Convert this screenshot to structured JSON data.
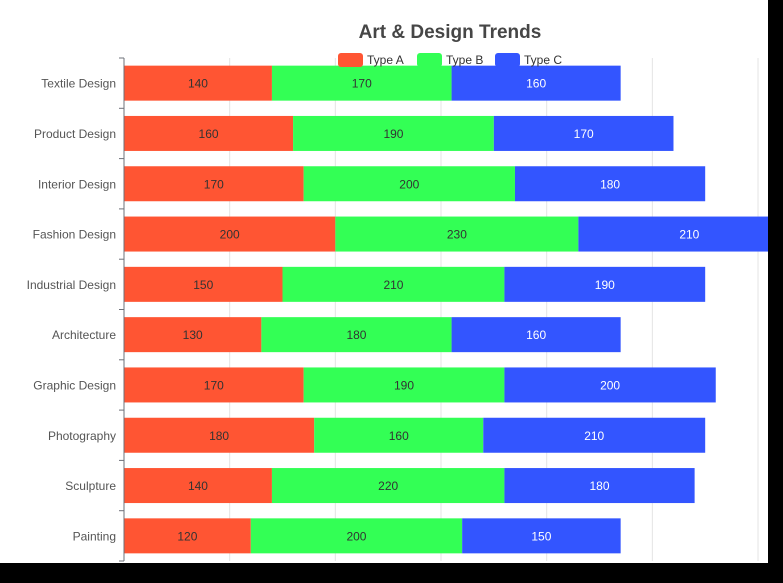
{
  "chart_data": {
    "type": "bar",
    "orientation": "horizontal",
    "stacked": true,
    "title": "Art & Design Trends",
    "categories": [
      "Textile Design",
      "Product Design",
      "Interior Design",
      "Fashion Design",
      "Industrial Design",
      "Architecture",
      "Graphic Design",
      "Photography",
      "Sculpture",
      "Painting"
    ],
    "series": [
      {
        "name": "Type A",
        "color": "#ff5533",
        "values": [
          140,
          160,
          170,
          200,
          150,
          130,
          170,
          180,
          140,
          120
        ]
      },
      {
        "name": "Type B",
        "color": "#33ff55",
        "values": [
          170,
          190,
          200,
          230,
          210,
          180,
          190,
          160,
          220,
          200
        ]
      },
      {
        "name": "Type C",
        "color": "#3355ff",
        "values": [
          160,
          170,
          180,
          210,
          190,
          160,
          200,
          210,
          180,
          150
        ]
      }
    ],
    "xlim": [
      0,
      600
    ],
    "grid": true,
    "legend": "top-center",
    "data_labels": true
  }
}
